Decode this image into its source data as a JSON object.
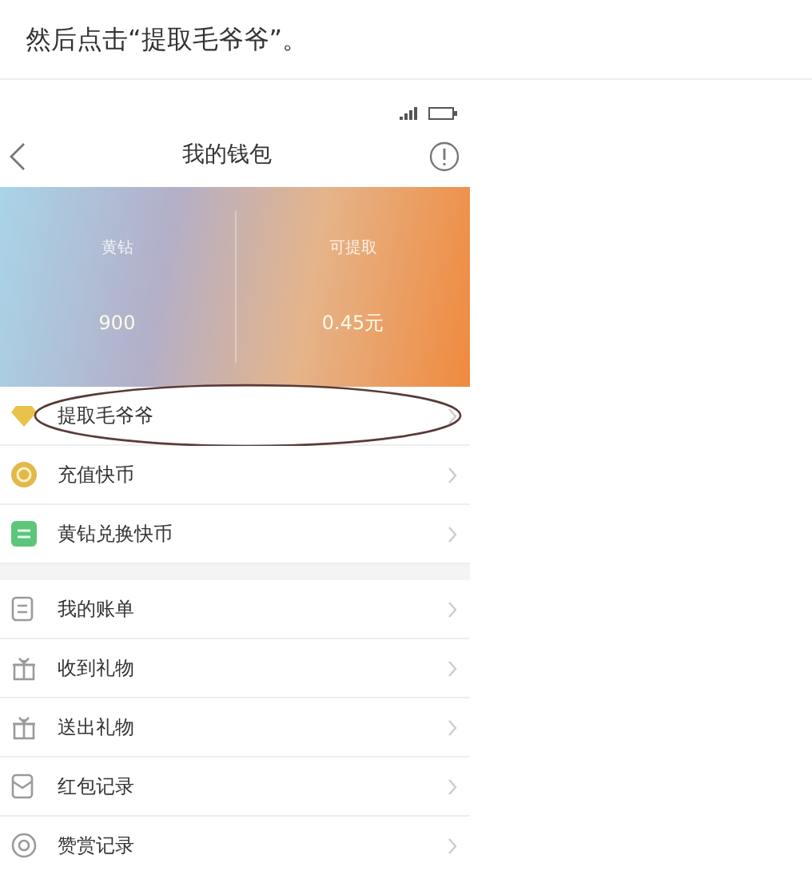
{
  "caption": "然后点击“提取毛爷爷”。",
  "nav": {
    "title": "我的钱包"
  },
  "banner": {
    "stats": [
      {
        "label": "黄钻",
        "value": "900"
      },
      {
        "label": "可提取",
        "value": "0.45元"
      }
    ]
  },
  "sections": [
    {
      "items": [
        {
          "label": "提取毛爷爷",
          "kind": "diamond",
          "circled": true
        },
        {
          "label": "充值快币",
          "kind": "coin",
          "circled": false
        },
        {
          "label": "黄钻兑换快币",
          "kind": "exchange",
          "circled": false
        }
      ]
    },
    {
      "items": [
        {
          "label": "我的账单",
          "kind": "bill",
          "circled": false
        },
        {
          "label": "收到礼物",
          "kind": "gift",
          "circled": false
        },
        {
          "label": "送出礼物",
          "kind": "gift",
          "circled": false
        },
        {
          "label": "红包记录",
          "kind": "envelope",
          "circled": false
        },
        {
          "label": "赞赏记录",
          "kind": "reward",
          "circled": false
        }
      ]
    }
  ]
}
